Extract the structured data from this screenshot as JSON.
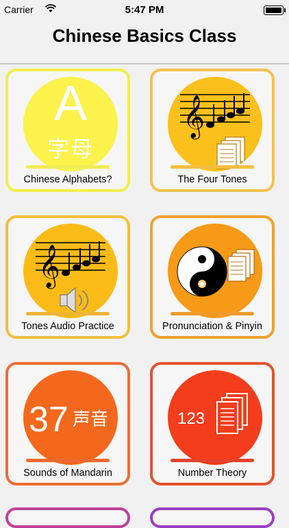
{
  "status_bar": {
    "carrier": "Carrier",
    "time": "5:47 PM"
  },
  "header": {
    "title": "Chinese Basics Class"
  },
  "tiles": [
    {
      "label": "Chinese Alphabets?",
      "glyph": "A",
      "glyph_sub": "字母",
      "circle_color": "#fbf24b",
      "border_color": "#f1ef4a",
      "bar_color": "#f0ec56"
    },
    {
      "label": "The Four Tones",
      "icon": "music-staff-document-icon",
      "circle_color": "#fbc01b",
      "border_color": "#f4c14d",
      "bar_color": "#f3be40"
    },
    {
      "label": "Tones Audio Practice",
      "icon": "music-staff-speaker-icon",
      "circle_color": "#fbbb17",
      "border_color": "#f3bf3c",
      "bar_color": "#f0b434"
    },
    {
      "label": "Pronunciation & Pinyin",
      "icon": "yin-yang-document-icon",
      "circle_color": "#f69a17",
      "border_color": "#f1a030",
      "bar_color": "#ef9a2b"
    },
    {
      "label": "Sounds of Mandarin",
      "glyph": "37",
      "glyph_sub": "声音",
      "circle_color": "#f3681c",
      "border_color": "#ed6d34",
      "bar_color": "#ec6a2f"
    },
    {
      "label": "Number Theory",
      "glyph": "123",
      "icon": "number-document-icon",
      "circle_color": "#f43d1c",
      "border_color": "#e6522d",
      "bar_color": "#e2432a"
    }
  ]
}
